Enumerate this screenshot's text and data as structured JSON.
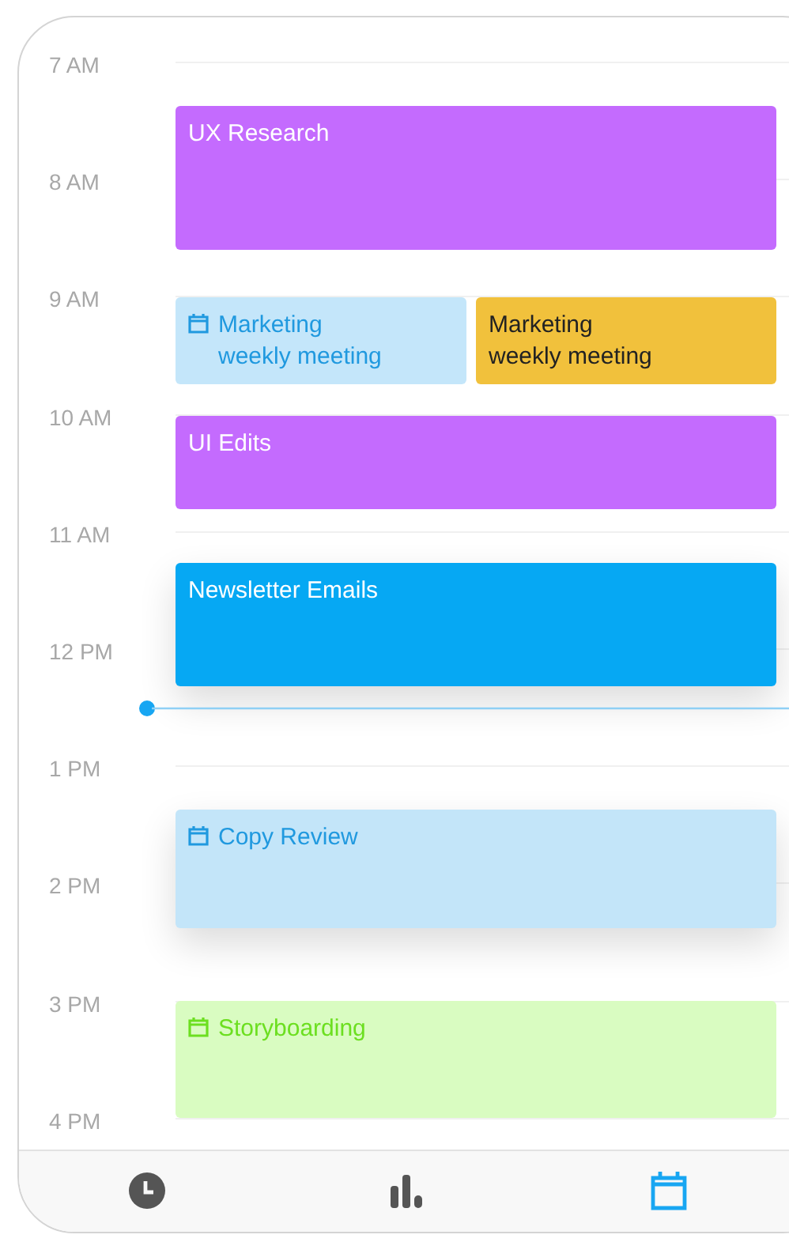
{
  "hours": [
    "7 AM",
    "8 AM",
    "9 AM",
    "10 AM",
    "11 AM",
    "12 PM",
    "1 PM",
    "2 PM",
    "3 PM",
    "4 PM"
  ],
  "events": [
    {
      "title": "UX Research",
      "kind": "plain",
      "color": "#c46bfe"
    },
    {
      "title": "Marketing\nweekly meeting",
      "kind": "calendar",
      "color": "#c4e6fa"
    },
    {
      "title": "Marketing\nweekly meeting",
      "kind": "plain",
      "color": "#f1c13c"
    },
    {
      "title": "UI Edits",
      "kind": "plain",
      "color": "#c46bfe"
    },
    {
      "title": "Newsletter Emails",
      "kind": "plain",
      "color": "#06a8f3"
    },
    {
      "title": "Copy Review",
      "kind": "calendar",
      "color": "#c3e5f9"
    },
    {
      "title": "Storyboarding",
      "kind": "calendar",
      "color": "#d9fcc1"
    }
  ],
  "tabs": [
    {
      "kind": "clock",
      "selected": false
    },
    {
      "kind": "stats",
      "selected": false
    },
    {
      "kind": "calendar",
      "selected": true
    }
  ]
}
